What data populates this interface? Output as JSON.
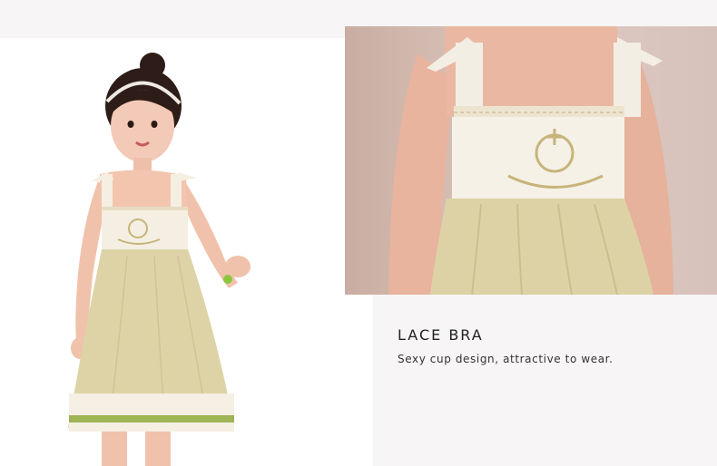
{
  "feature": {
    "title": "LACE BRA",
    "description": "Sexy cup design, attractive to wear."
  },
  "colors": {
    "panel_background": "#f7f5f6",
    "dress_skirt": "#ddd3a6",
    "dress_bodice": "#f4efe2",
    "embroidery": "#c8b47a",
    "trim_green": "#9eb455",
    "skin": "#f0c3ae"
  },
  "images": {
    "left": "girl-in-sleeveless-dress-photo",
    "right": "dress-bodice-closeup-photo"
  }
}
